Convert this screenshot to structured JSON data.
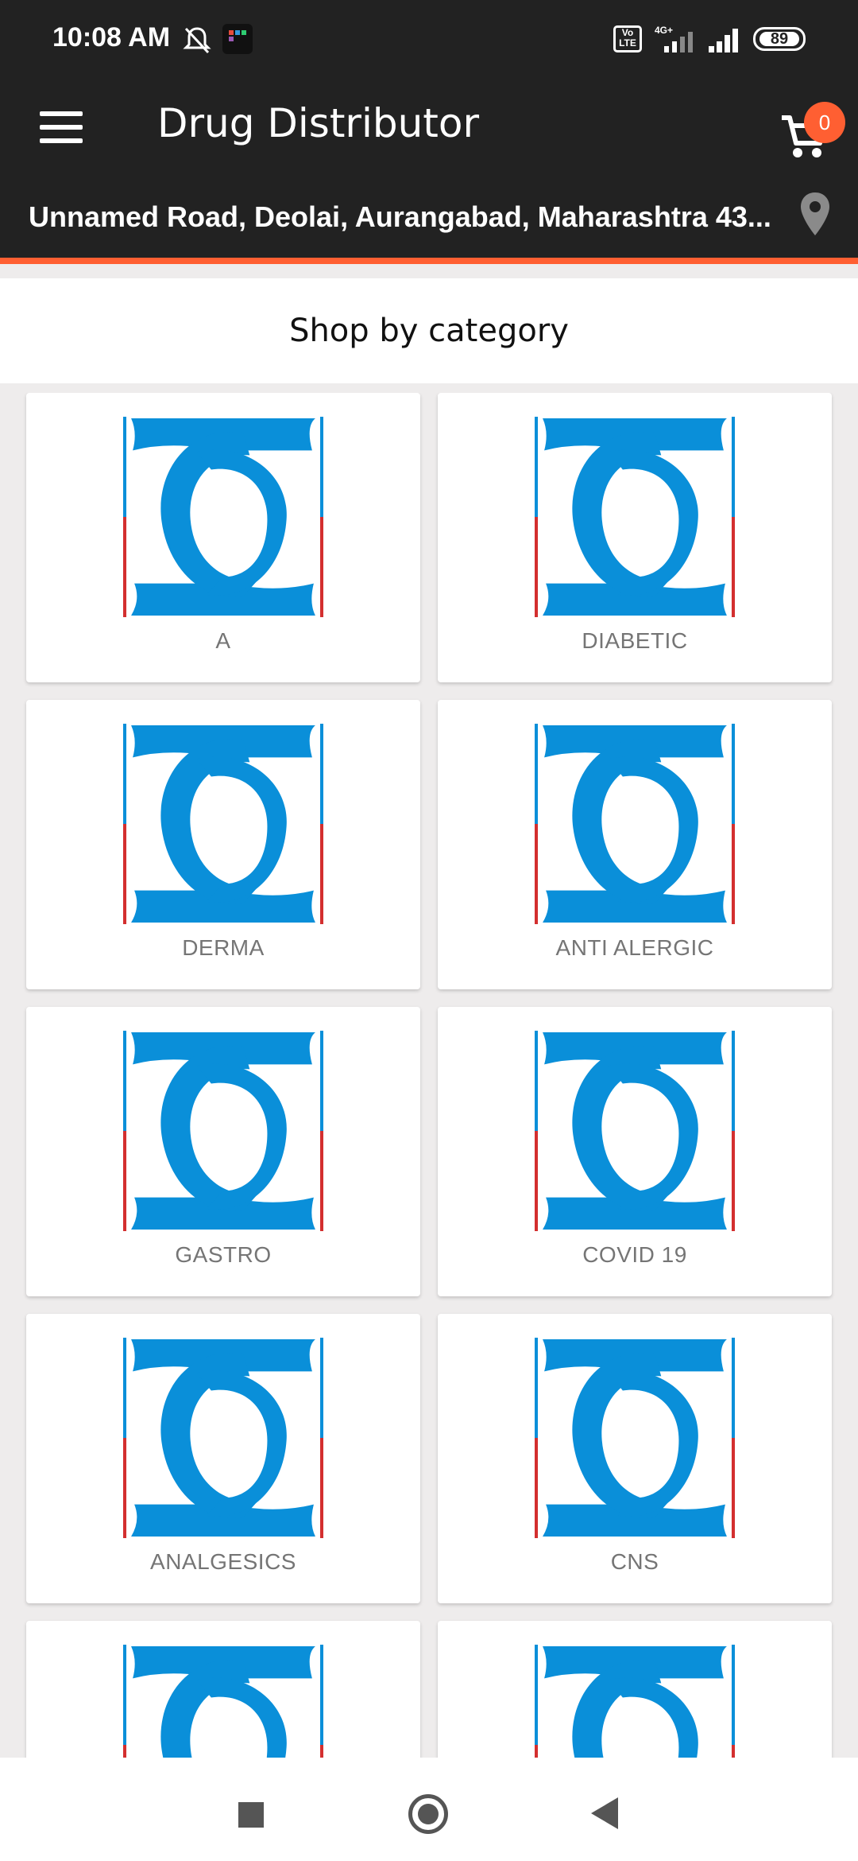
{
  "status_bar": {
    "time": "10:08 AM",
    "volte_label": "Vo LTE",
    "network_label": "4G+",
    "battery": "89"
  },
  "app_bar": {
    "title": "Drug Distributor",
    "cart_count": "0",
    "address": "Unnamed Road, Deolai, Aurangabad, Maharashtra 43..."
  },
  "section": {
    "title": "Shop by category"
  },
  "categories": [
    {
      "label": "A"
    },
    {
      "label": "DIABETIC"
    },
    {
      "label": "DERMA"
    },
    {
      "label": "ANTI ALERGIC"
    },
    {
      "label": "GASTRO"
    },
    {
      "label": "COVID 19"
    },
    {
      "label": "ANALGESICS"
    },
    {
      "label": "CNS"
    },
    {
      "label": ""
    },
    {
      "label": ""
    }
  ],
  "colors": {
    "toolbar": "#222222",
    "accent": "#ff5f32",
    "logo_blue": "#0a8fd9",
    "logo_red": "#d32f2f",
    "label_gray": "#757575"
  },
  "icons": {
    "menu": "menu-icon",
    "cart": "cart-icon",
    "location": "location-pin-icon",
    "nav_recents": "square-icon",
    "nav_home": "circle-icon",
    "nav_back": "triangle-back-icon"
  }
}
